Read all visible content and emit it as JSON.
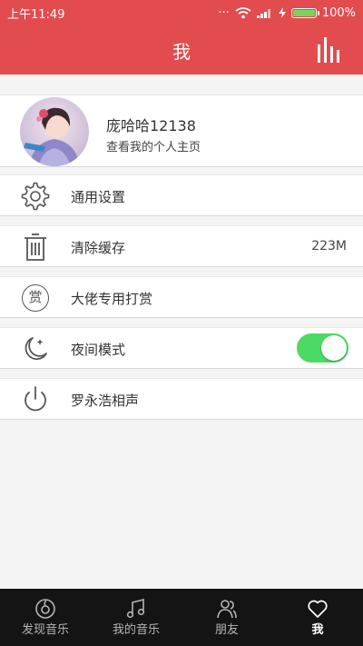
{
  "status_bar": {
    "time": "上午11:49",
    "battery_percent": "100%"
  },
  "header": {
    "title": "我",
    "stats_icon": "bar-chart-icon"
  },
  "profile": {
    "name": "庞哈哈12138",
    "subtitle": "查看我的个人主页"
  },
  "menu": [
    {
      "label": "通用设置",
      "icon": "gear-icon"
    },
    {
      "label": "清除缓存",
      "icon": "trash-icon",
      "value": "223M"
    },
    {
      "label": "大佬专用打赏",
      "icon": "reward-icon",
      "icon_text": "赏"
    },
    {
      "label": "夜间模式",
      "icon": "moon-icon",
      "toggle_on": true
    },
    {
      "label": "罗永浩相声",
      "icon": "power-icon"
    }
  ],
  "bottom_nav": [
    {
      "label": "发现音乐",
      "icon": "disc-icon"
    },
    {
      "label": "我的音乐",
      "icon": "music-note-icon"
    },
    {
      "label": "朋友",
      "icon": "friends-icon"
    },
    {
      "label": "我",
      "icon": "heart-icon",
      "active": true
    }
  ],
  "colors": {
    "brand_red": "#e24c4e",
    "toggle_green": "#4cd964",
    "nav_bg": "#141414"
  }
}
